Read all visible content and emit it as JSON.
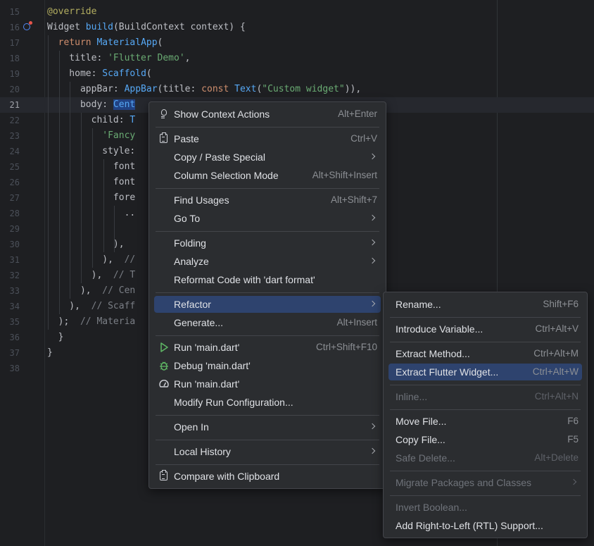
{
  "editor": {
    "lines": [
      {
        "n": "15",
        "html": "<span class='tok-ann'>@override</span>",
        "guides": []
      },
      {
        "n": "16",
        "html": "Widget <span class='tok-cls'>build</span>(BuildContext context) {",
        "guides": [],
        "icon": true
      },
      {
        "n": "17",
        "html": "  <span class='tok-kw'>return</span> <span class='tok-cls'>MaterialApp</span>(",
        "guides": [
          1
        ]
      },
      {
        "n": "18",
        "html": "    title: <span class='tok-str'>'Flutter Demo'</span>,",
        "guides": [
          1,
          2
        ]
      },
      {
        "n": "19",
        "html": "    home: <span class='tok-cls'>Scaffold</span>(",
        "guides": [
          1,
          2
        ]
      },
      {
        "n": "20",
        "html": "      appBar: <span class='tok-cls'>AppBar</span>(title: <span class='tok-kw'>const</span> <span class='tok-cls'>Text</span>(<span class='tok-str'>\"Custom widget\"</span>)),",
        "guides": [
          1,
          2,
          3
        ]
      },
      {
        "n": "21",
        "html": "      body: <span class='tok-cls tok-sel'>Cent</span>",
        "guides": [
          1,
          2,
          3
        ],
        "current": true
      },
      {
        "n": "22",
        "html": "        child: <span class='tok-cls'>T</span>",
        "guides": [
          1,
          2,
          3,
          4
        ]
      },
      {
        "n": "23",
        "html": "          <span class='tok-str'>'Fancy</span>",
        "guides": [
          1,
          2,
          3,
          4,
          5
        ]
      },
      {
        "n": "24",
        "html": "          style:",
        "guides": [
          1,
          2,
          3,
          4,
          5
        ]
      },
      {
        "n": "25",
        "html": "            font",
        "guides": [
          1,
          2,
          3,
          4,
          5,
          6
        ]
      },
      {
        "n": "26",
        "html": "            font",
        "guides": [
          1,
          2,
          3,
          4,
          5,
          6
        ]
      },
      {
        "n": "27",
        "html": "            fore",
        "guides": [
          1,
          2,
          3,
          4,
          5,
          6
        ]
      },
      {
        "n": "28",
        "html": "              ..",
        "guides": [
          1,
          2,
          3,
          4,
          5,
          6,
          7
        ]
      },
      {
        "n": "29",
        "html": "",
        "guides": [
          1,
          2,
          3,
          4,
          5,
          6,
          7
        ]
      },
      {
        "n": "30",
        "html": "            ),",
        "guides": [
          1,
          2,
          3,
          4,
          5,
          6,
          7
        ]
      },
      {
        "n": "31",
        "html": "          ),  <span class='tok-cm'>//</span>",
        "guides": [
          1,
          2,
          3,
          4,
          5
        ]
      },
      {
        "n": "32",
        "html": "        ),  <span class='tok-cm'>// T</span>",
        "guides": [
          1,
          2,
          3,
          4
        ]
      },
      {
        "n": "33",
        "html": "      ),  <span class='tok-cm'>// Cen</span>",
        "guides": [
          1,
          2,
          3
        ]
      },
      {
        "n": "34",
        "html": "    ),  <span class='tok-cm'>// Scaff</span>",
        "guides": [
          1,
          2
        ]
      },
      {
        "n": "35",
        "html": "  );  <span class='tok-cm'>// Materia</span>",
        "guides": [
          1
        ]
      },
      {
        "n": "36",
        "html": "  }",
        "guides": []
      },
      {
        "n": "37",
        "html": "}",
        "guides": []
      },
      {
        "n": "38",
        "html": "",
        "guides": []
      }
    ]
  },
  "context_menu": {
    "items": [
      {
        "label": "Show Context Actions",
        "shortcut": "Alt+Enter",
        "icon": "bulb-icon"
      },
      {
        "sep": true
      },
      {
        "label": "Paste",
        "shortcut": "Ctrl+V",
        "icon": "clipboard-icon"
      },
      {
        "label": "Copy / Paste Special",
        "submenu": true
      },
      {
        "label": "Column Selection Mode",
        "shortcut": "Alt+Shift+Insert"
      },
      {
        "sep": true
      },
      {
        "label": "Find Usages",
        "shortcut": "Alt+Shift+7"
      },
      {
        "label": "Go To",
        "submenu": true
      },
      {
        "sep": true
      },
      {
        "label": "Folding",
        "submenu": true
      },
      {
        "label": "Analyze",
        "submenu": true
      },
      {
        "label": "Reformat Code with 'dart format'"
      },
      {
        "sep": true
      },
      {
        "label": "Refactor",
        "submenu": true,
        "selected": true
      },
      {
        "label": "Generate...",
        "shortcut": "Alt+Insert"
      },
      {
        "sep": true
      },
      {
        "label": "Run 'main.dart'",
        "shortcut": "Ctrl+Shift+F10",
        "icon": "run-icon"
      },
      {
        "label": "Debug 'main.dart'",
        "icon": "debug-icon"
      },
      {
        "label": "Run 'main.dart'",
        "icon": "profile-icon"
      },
      {
        "label": "Modify Run Configuration..."
      },
      {
        "sep": true
      },
      {
        "label": "Open In",
        "submenu": true
      },
      {
        "sep": true
      },
      {
        "label": "Local History",
        "submenu": true
      },
      {
        "sep": true
      },
      {
        "label": "Compare with Clipboard",
        "icon": "compare-icon"
      }
    ]
  },
  "refactor_submenu": {
    "items": [
      {
        "label": "Rename...",
        "shortcut": "Shift+F6"
      },
      {
        "sep": true
      },
      {
        "label": "Introduce Variable...",
        "shortcut": "Ctrl+Alt+V"
      },
      {
        "sep": true
      },
      {
        "label": "Extract Method...",
        "shortcut": "Ctrl+Alt+M"
      },
      {
        "label": "Extract Flutter Widget...",
        "shortcut": "Ctrl+Alt+W",
        "selected": true
      },
      {
        "sep": true
      },
      {
        "label": "Inline...",
        "shortcut": "Ctrl+Alt+N",
        "disabled": true
      },
      {
        "sep": true
      },
      {
        "label": "Move File...",
        "shortcut": "F6"
      },
      {
        "label": "Copy File...",
        "shortcut": "F5"
      },
      {
        "label": "Safe Delete...",
        "shortcut": "Alt+Delete",
        "disabled": true
      },
      {
        "sep": true
      },
      {
        "label": "Migrate Packages and Classes",
        "submenu": true,
        "disabled": true
      },
      {
        "sep": true
      },
      {
        "label": "Invert Boolean...",
        "disabled": true
      },
      {
        "label": "Add Right-to-Left (RTL) Support..."
      }
    ]
  }
}
